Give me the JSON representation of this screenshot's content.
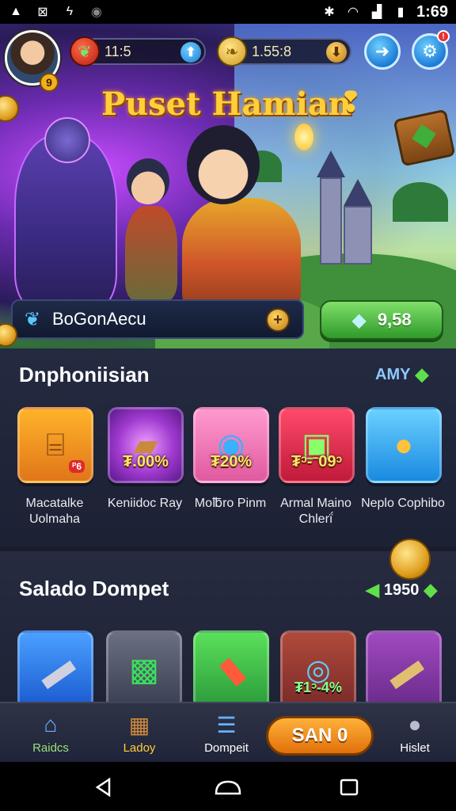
{
  "status_bar": {
    "time": "1:69"
  },
  "hud": {
    "level": "9",
    "pepper_value": "11:5",
    "gold_value": "1.55:8"
  },
  "game_title": "Puset Hamian",
  "player": {
    "name": "BoGonAecu"
  },
  "gems_button": {
    "value": "9,58"
  },
  "section1": {
    "title": "Dnphoniisian",
    "link": "AMY",
    "items": [
      {
        "badge": "",
        "label": "Macatalke Uolmaha",
        "sub_badge": "ᴾ6"
      },
      {
        "badge": "₮.00%",
        "label": "Keniidoc Ray"
      },
      {
        "badge": "₮20%",
        "label": "Mo℔ro Pinm"
      },
      {
        "badge": "₮ᵓ-ᐨ09ᵓ",
        "label": "Armal Maino Chlerḯ"
      },
      {
        "badge": "",
        "label": "Neplo Cophibo"
      }
    ]
  },
  "section2": {
    "title": "Salado Dompet",
    "count": "1950",
    "items": [
      {
        "badge": ""
      },
      {
        "badge": ""
      },
      {
        "badge": ""
      },
      {
        "badge": "₮1ᵓ-4%"
      },
      {
        "badge": ""
      }
    ]
  },
  "bottom_nav": {
    "items": [
      "Raidcs",
      "Ladoy",
      "Dompeit",
      "Hislet"
    ],
    "center_button": "SAN 0"
  },
  "colors": {
    "accent_gold": "#ffcf3a",
    "green_button": "#2f9a2a",
    "orange_button": "#e0700a"
  }
}
